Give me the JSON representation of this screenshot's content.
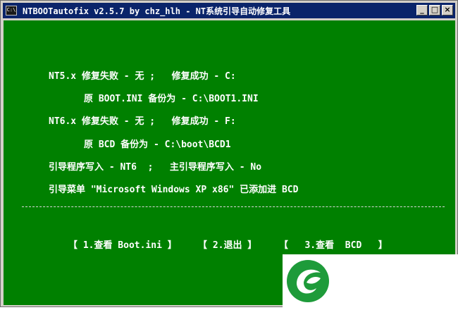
{
  "window": {
    "title": "NTBOOTautofix v2.5.7 by chz_hlh - NT系统引导自动修复工具",
    "icon_label": "C:\\",
    "buttons": [
      "minimize-icon",
      "maximize-icon",
      "close-icon"
    ]
  },
  "console": {
    "lines": [
      "NT5.x 修复失败 - 无 ;   修复成功 - C:",
      "原 BOOT.INI 备份为 - C:\\BOOT1.INI",
      "NT6.x 修复失败 - 无 ;   修复成功 - F:",
      "原 BCD 备份为 - C:\\boot\\BCD1",
      "引导程序写入 - NT6  ;   主引导程序写入 - No",
      "引导菜单 \"Microsoft Windows XP x86\" 已添加进 BCD"
    ],
    "divider": "----------------------------------------------------------------------------"
  },
  "menu": {
    "view_bootini": "【 1.查看 Boot.ini 】",
    "exit": "【 2.退出 】",
    "view_bcd": "【   3.查看  BCD   】"
  },
  "colors": {
    "console_bg": "#008000",
    "titlebar_bg": "#0a246a",
    "text": "#ffffff"
  }
}
